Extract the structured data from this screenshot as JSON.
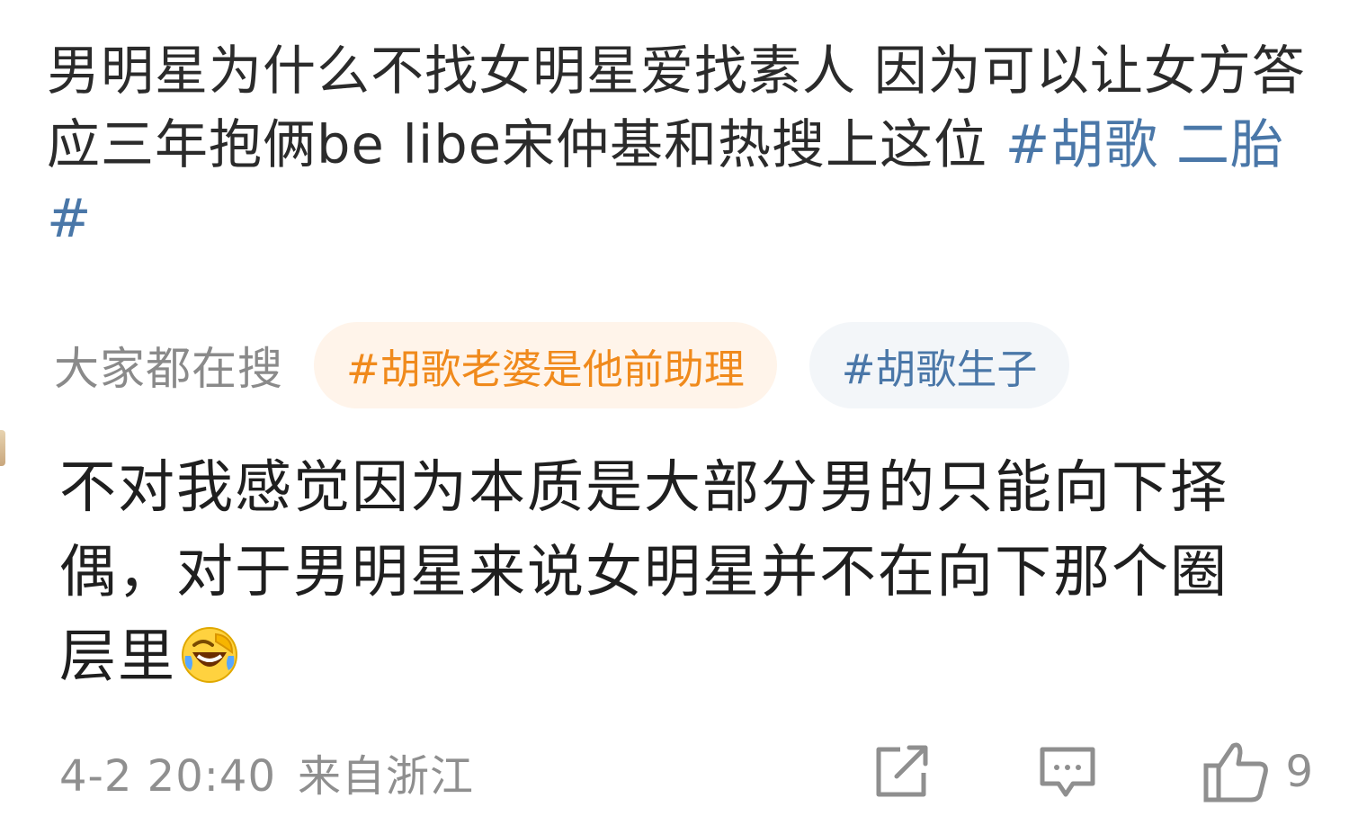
{
  "post": {
    "text": "男明星为什么不找女明星爱找素人 因为可以让女方答应三年抱俩be libe宋仲基和热搜上这位 ",
    "hashtag": "#胡歌 二胎#"
  },
  "trending": {
    "label": "大家都在搜",
    "chips": [
      {
        "text": "#胡歌老婆是他前助理",
        "style": "hot"
      },
      {
        "text": "#胡歌生子",
        "style": "normal"
      }
    ]
  },
  "comment": {
    "text": "不对我感觉因为本质是大部分男的只能向下择偶，对于男明星来说女明星并不在向下那个圈层里",
    "emoji": "laugh-crying-emoji"
  },
  "footer": {
    "date": "4-2 20:40",
    "location": "来自浙江",
    "like_count": "9",
    "icons": [
      "share-icon",
      "comment-icon",
      "like-icon"
    ]
  },
  "colors": {
    "text": "#2b2b2b",
    "hashtag": "#4a77a8",
    "hot_chip_text": "#f08a1c",
    "hot_chip_bg": "#fff4ea",
    "normal_chip_bg": "#f3f6f9",
    "meta": "#8f8f8f"
  }
}
